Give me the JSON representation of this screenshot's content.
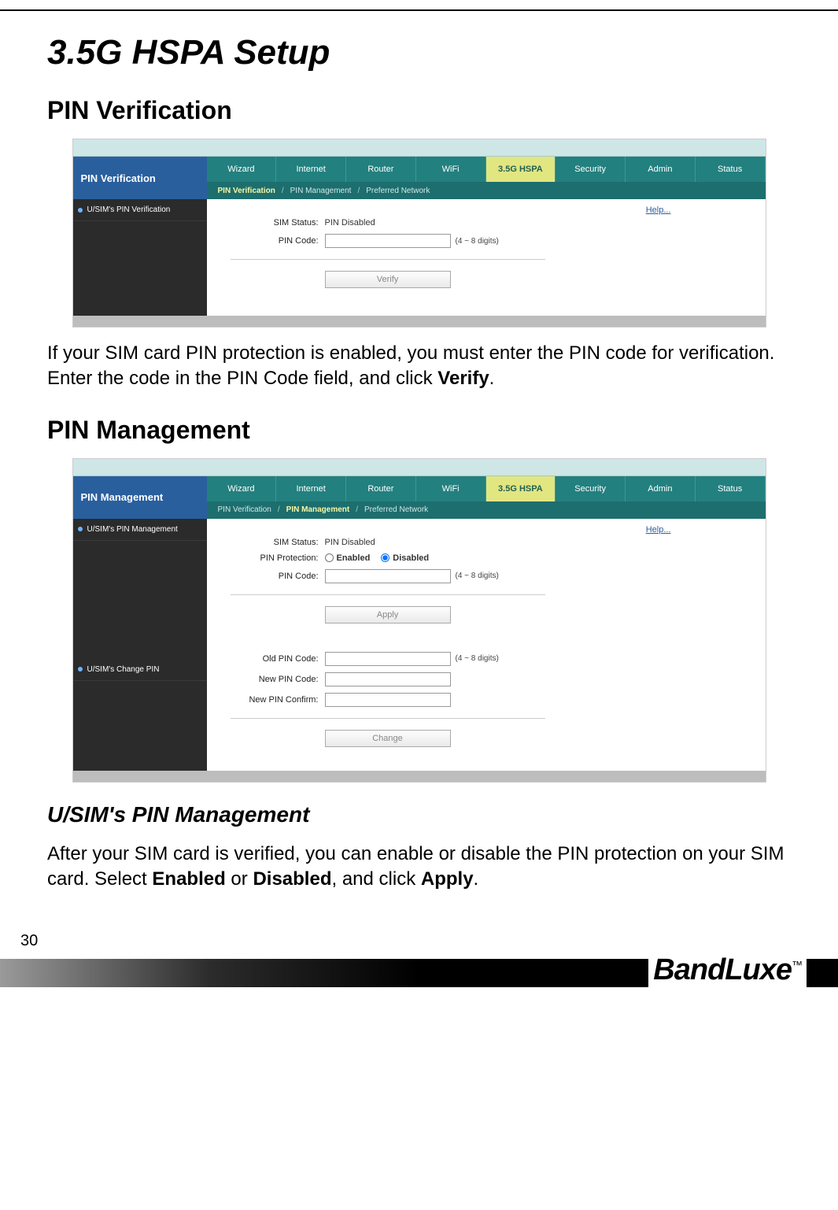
{
  "page": {
    "title": "3.5G HSPA Setup",
    "section1_title": "PIN Verification",
    "section1_body_pre": "If your SIM card PIN protection is enabled, you must enter the PIN code for verification. Enter the code in the PIN Code field, and click ",
    "section1_body_bold": "Verify",
    "section1_body_post": ".",
    "section2_title": "PIN Management",
    "section3_title": "U/SIM's PIN Management",
    "section3_body_pre": "After your SIM card is verified, you can enable or disable the PIN protection on your SIM card. Select ",
    "section3_b1": "Enabled",
    "section3_mid": " or ",
    "section3_b2": "Disabled",
    "section3_mid2": ", and click ",
    "section3_b3": "Apply",
    "section3_post": ".",
    "page_number": "30",
    "brand": "BandLuxe",
    "brand_tm": "™"
  },
  "tabs": [
    "Wizard",
    "Internet",
    "Router",
    "WiFi",
    "3.5G HSPA",
    "Security",
    "Admin",
    "Status"
  ],
  "subtabs": [
    "PIN Verification",
    "PIN Management",
    "Preferred Network"
  ],
  "shot1": {
    "title": "PIN Verification",
    "side_item": "U/SIM's PIN Verification",
    "help": "Help...",
    "sim_status_label": "SIM Status:",
    "sim_status_value": "PIN Disabled",
    "pin_code_label": "PIN Code:",
    "hint": "(4 ~ 8 digits)",
    "button": "Verify",
    "subtab_active_index": 0
  },
  "shot2": {
    "title": "PIN Management",
    "side_item1": "U/SIM's PIN Management",
    "side_item2": "U/SIM's Change PIN",
    "help": "Help...",
    "sim_status_label": "SIM Status:",
    "sim_status_value": "PIN Disabled",
    "pin_protection_label": "PIN Protection:",
    "radio_enabled": "Enabled",
    "radio_disabled": "Disabled",
    "pin_code_label": "PIN Code:",
    "hint": "(4 ~ 8 digits)",
    "apply_button": "Apply",
    "old_pin_label": "Old PIN Code:",
    "new_pin_label": "New PIN Code:",
    "new_pin_confirm_label": "New PIN Confirm:",
    "change_button": "Change",
    "subtab_active_index": 1
  }
}
